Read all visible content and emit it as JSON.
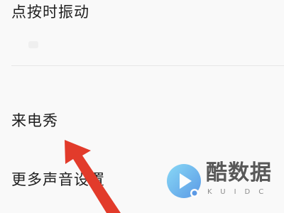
{
  "settings_list": {
    "items": [
      {
        "label": "点按时振动"
      },
      {
        "label": "来电秀"
      },
      {
        "label": "更多声音设置"
      }
    ]
  },
  "watermark": {
    "title": "酷数据",
    "subtitle": "KUIDC",
    "logo_icon": "play-logo-icon"
  },
  "colors": {
    "background": "#f9f9f9",
    "text": "#1d1d1d",
    "arrow": "#e23b2b",
    "logo_blue": "#3aa6ec"
  }
}
